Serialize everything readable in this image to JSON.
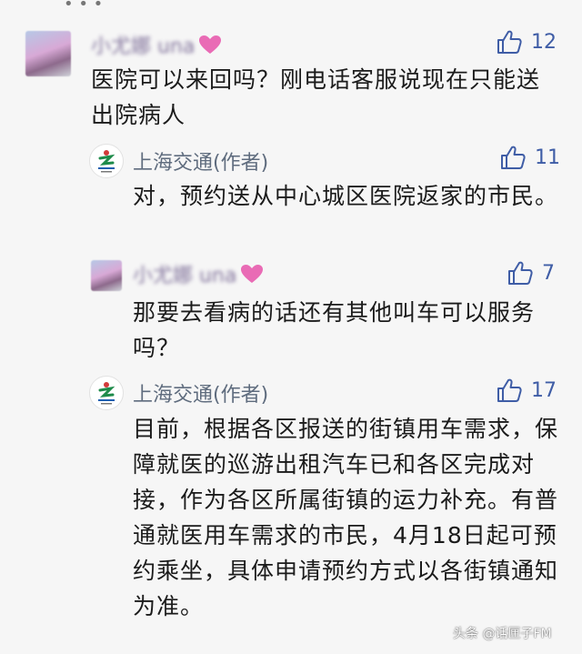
{
  "thread": [
    {
      "author": "小尤娜 una",
      "likes": "12",
      "text": "医院可以来回吗？刚电话客服说现在只能送出院病人"
    },
    {
      "author": "上海交通(作者)",
      "likes": "11",
      "text": "对，预约送从中心城区医院返家的市民。"
    },
    {
      "author": "小尤娜 una",
      "likes": "7",
      "text": "那要去看病的话还有其他叫车可以服务吗？"
    },
    {
      "author": "上海交通(作者)",
      "likes": "17",
      "text": "目前，根据各区报送的街镇用车需求，保障就医的巡游出租汽车已和各区完成对接，作为各区所属街镇的运力补充。有普通就医用车需求的市民，4月18日起可预约乘坐，具体申请预约方式以各街镇通知为准。"
    }
  ],
  "watermark": "头条 @话匣子FM",
  "colors": {
    "background": "#f6f6f6",
    "like_blue": "#3f5da6",
    "author_gray": "#5f6c7e"
  },
  "icons": [
    "thumbs-up-icon",
    "heart-icon",
    "shanghai-transport-logo-icon"
  ]
}
